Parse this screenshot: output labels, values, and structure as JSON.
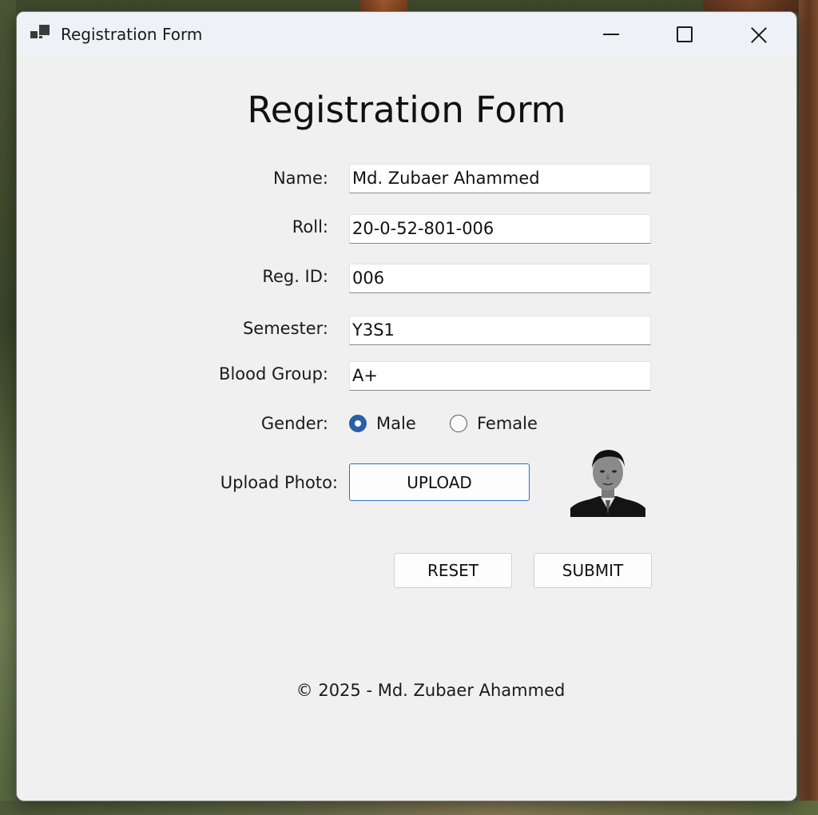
{
  "window": {
    "title": "Registration Form"
  },
  "form": {
    "heading": "Registration Form",
    "fields": {
      "name": {
        "label": "Name:",
        "value": "Md. Zubaer Ahammed"
      },
      "roll": {
        "label": "Roll:",
        "value": "20-0-52-801-006"
      },
      "reg_id": {
        "label": "Reg. ID:",
        "value": "006"
      },
      "semester": {
        "label": "Semester:",
        "value": "Y3S1"
      },
      "blood_group": {
        "label": "Blood Group:",
        "value": "A+"
      }
    },
    "gender": {
      "label": "Gender:",
      "options": [
        {
          "label": "Male",
          "checked": true
        },
        {
          "label": "Female",
          "checked": false
        }
      ]
    },
    "upload": {
      "label": "Upload Photo:",
      "button_label": "UPLOAD"
    },
    "buttons": {
      "reset_label": "RESET",
      "submit_label": "SUBMIT"
    }
  },
  "footer": {
    "text": "© 2025 - Md. Zubaer Ahammed"
  },
  "colors": {
    "accent": "#2b5ea9",
    "window_bg": "#f0f0f0",
    "titlebar_bg": "#eef1f6"
  },
  "icons": {
    "app": "app-windows-icon",
    "minimize": "minimize-icon",
    "maximize": "maximize-icon",
    "close": "close-icon"
  }
}
